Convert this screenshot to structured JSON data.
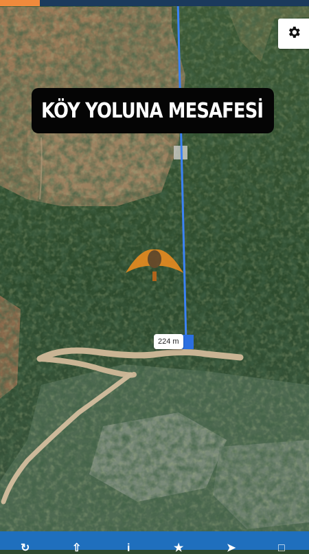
{
  "map": {
    "type": "satellite",
    "title": "KÖY YOLUNA MESAFESİ",
    "distance_label": "224 m",
    "line_color": "#3b82f6",
    "top_strip_color": "#1b3a5c",
    "top_accent_color": "#f08a3c",
    "bottom_bar_color": "#1f6fbd"
  },
  "toolbar": {
    "settings_icon": "gear-icon"
  },
  "bottom_nav": {
    "icons": [
      "refresh-icon",
      "upload-icon",
      "info-icon",
      "star-icon",
      "share-icon",
      "file-icon"
    ]
  }
}
